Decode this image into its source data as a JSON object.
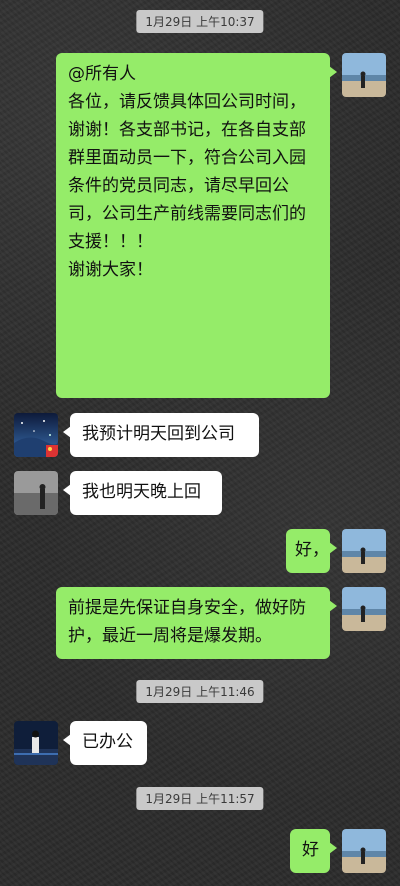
{
  "timestamps": {
    "t1": "1月29日 上午10:37",
    "t2": "1月29日 上午11:46",
    "t3": "1月29日 上午11:57"
  },
  "messages": [
    {
      "side": "right",
      "lines": [
        "@所有人",
        "各位，请反馈具体回公司时间，",
        "谢谢！各支部书记，在各自支部",
        "群里面动员一下，符合公司入园",
        "条件的党员同志，请尽早回公",
        "司，公司生产前线需要同志们的",
        "支援！！！",
        "谢谢大家！"
      ]
    },
    {
      "side": "left",
      "lines": [
        "我预计明天回到公司"
      ]
    },
    {
      "side": "left",
      "lines": [
        "我也明天晚上回"
      ]
    },
    {
      "side": "right",
      "lines": [
        "好，"
      ]
    },
    {
      "side": "right",
      "lines": [
        "前提是先保证自身安全，做好防",
        "护，最近一周将是爆发期。"
      ]
    },
    {
      "side": "left",
      "lines": [
        "已办公"
      ]
    },
    {
      "side": "right",
      "lines": [
        "好"
      ]
    }
  ],
  "colors": {
    "sent_bubble": "#95ec69",
    "received_bubble": "#ffffff",
    "timestamp_bg": "#c9c9c9"
  }
}
